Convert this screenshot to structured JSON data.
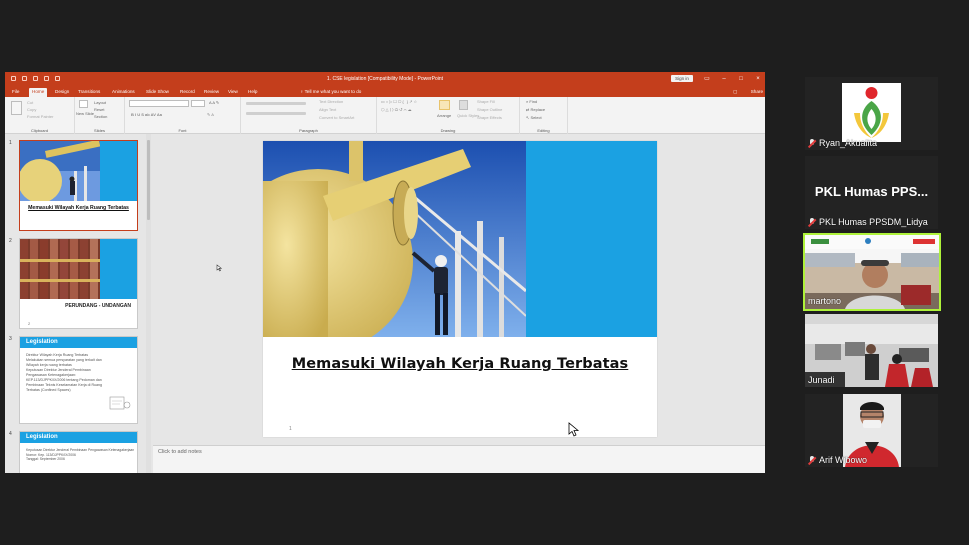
{
  "window": {
    "title": "1. CSE legislation [Compatibility Mode] - PowerPoint",
    "signin": "Sign in",
    "tell_me": "Tell me what you want to do",
    "share": "Share"
  },
  "tabs": [
    "File",
    "Home",
    "Design",
    "Transitions",
    "Animations",
    "Slide Show",
    "Record",
    "Review",
    "View",
    "Help"
  ],
  "active_tab": "Home",
  "ribbon": {
    "groups": [
      "Clipboard",
      "Slides",
      "Font",
      "Paragraph",
      "Drawing",
      "Editing"
    ],
    "clipboard": {
      "cut": "Cut",
      "copy": "Copy",
      "format_painter": "Format Painter"
    },
    "slides": {
      "new_slide": "New Slide",
      "layout": "Layout",
      "reset": "Reset",
      "section": "Section"
    },
    "paragraph": {
      "text_direction": "Text Direction",
      "align_text": "Align Text",
      "convert_smartart": "Convert to SmartArt"
    },
    "drawing": {
      "arrange": "Arrange",
      "quick_styles": "Quick Styles",
      "shape_fill": "Shape Fill",
      "shape_outline": "Shape Outline",
      "shape_effects": "Shape Effects"
    },
    "editing": {
      "find": "Find",
      "replace": "Replace",
      "select": "Select"
    }
  },
  "thumbnails": [
    {
      "number": "1",
      "title": "Memasuki Wilayah Kerja Ruang Terbatas"
    },
    {
      "number": "2",
      "title": "PERUNDANG - UNDANGAN",
      "page": "2"
    },
    {
      "number": "3",
      "header": "Legislation",
      "lines": [
        "Direktur Wilayah Kerja Ruang Terbatas",
        "Melakukan semua persyaratan yang terkait dan",
        "Wilayah kerja ruang terbatas",
        "Keputusan Direktur Jenderal Pembinaan Pengawasan Ketenagakerjaan: KEP.113/DJPPK/IX/2006 tentang Pedoman dan Pembinaan Teknis Keselamatan Kerja di Ruang Terbatas (Confined Spaces)"
      ]
    },
    {
      "number": "4",
      "header": "Legislation",
      "lines": [
        "Keputusan Direktur Jenderal Pembinaan Pengawasan Ketenagakerjaan",
        "Nomor: Kep. 113/DJPPK/IX/2006",
        "Tanggal: September 2006"
      ]
    }
  ],
  "slide": {
    "title": "Memasuki Wilayah Kerja Ruang Terbatas",
    "number": "1"
  },
  "notes_placeholder": "Click to add notes",
  "participants": [
    {
      "name": "Ryan_Akualita",
      "muted": true
    },
    {
      "name": "PKL Humas PPSDM_Lidya",
      "display": "PKL Humas PPS...",
      "muted": true
    },
    {
      "name": "martono",
      "muted": false,
      "active": true
    },
    {
      "name": "Junadi",
      "muted": false
    },
    {
      "name": "Arif Wibowo",
      "muted": true
    }
  ],
  "colors": {
    "ppt_accent": "#c43e1c",
    "slide_blue": "#1ba1e2",
    "active_speaker": "#aef23a"
  }
}
